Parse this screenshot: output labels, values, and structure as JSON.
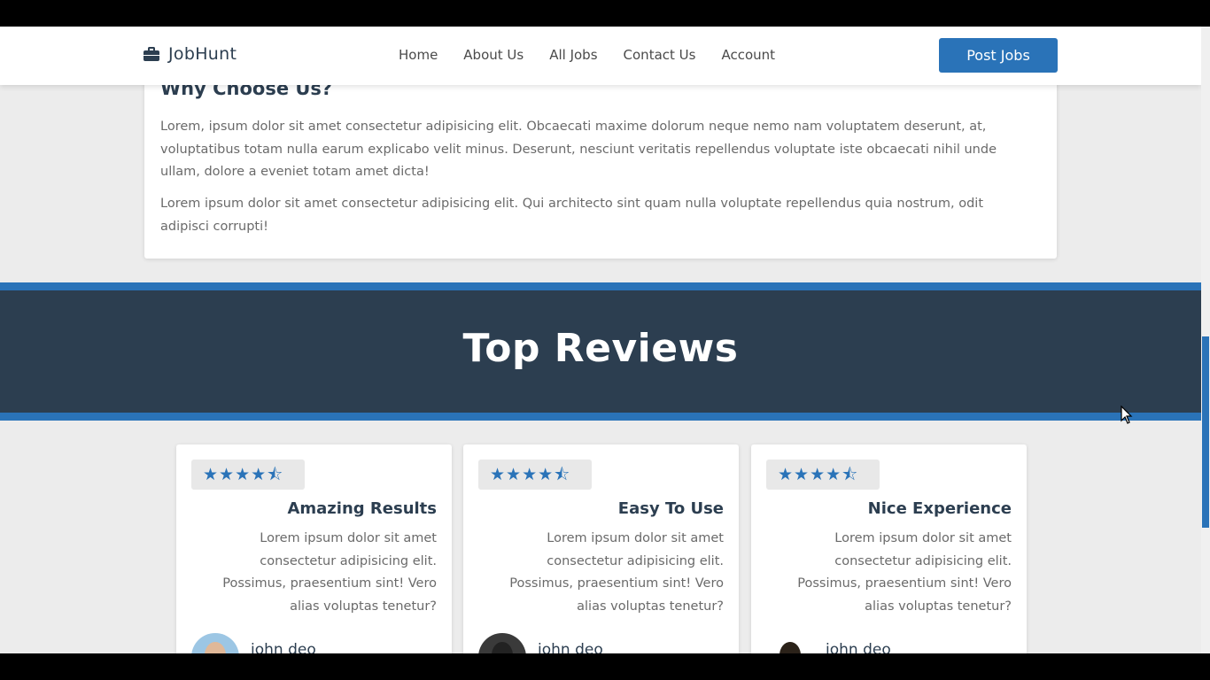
{
  "header": {
    "logo_text": "JobHunt",
    "nav": [
      {
        "label": "Home"
      },
      {
        "label": "About Us"
      },
      {
        "label": "All Jobs"
      },
      {
        "label": "Contact Us"
      },
      {
        "label": "Account"
      }
    ],
    "post_button": "Post Jobs"
  },
  "why": {
    "title": "Why Choose Us?",
    "paragraph1": "Lorem, ipsum dolor sit amet consectetur adipisicing elit. Obcaecati maxime dolorum neque nemo nam voluptatem deserunt, at, voluptatibus totam nulla earum explicabo velit minus. Deserunt, nesciunt veritatis repellendus voluptate iste obcaecati nihil unde ullam, dolore a eveniet totam amet dicta!",
    "paragraph2": "Lorem ipsum dolor sit amet consectetur adipisicing elit. Qui architecto sint quam nulla voluptate repellendus quia nostrum, odit adipisci corrupti!"
  },
  "reviews": {
    "title": "Top Reviews",
    "rating_stars": 4.5,
    "cards": [
      {
        "heading": "Amazing Results",
        "text": "Lorem ipsum dolor sit amet consectetur adipisicing elit. Possimus, praesentium sint! Vero alias voluptas tenetur?",
        "name": "john deo"
      },
      {
        "heading": "Easy To Use",
        "text": "Lorem ipsum dolor sit amet consectetur adipisicing elit. Possimus, praesentium sint! Vero alias voluptas tenetur?",
        "name": "john deo"
      },
      {
        "heading": "Nice Experience",
        "text": "Lorem ipsum dolor sit amet consectetur adipisicing elit. Possimus, praesentium sint! Vero alias voluptas tenetur?",
        "name": "john deo"
      }
    ]
  },
  "colors": {
    "accent": "#2a73b8",
    "dark": "#2c3e50",
    "background": "#ececec"
  },
  "icons": {
    "logo": "briefcase-icon",
    "star_full": "star-icon",
    "star_half": "star-half-icon"
  }
}
